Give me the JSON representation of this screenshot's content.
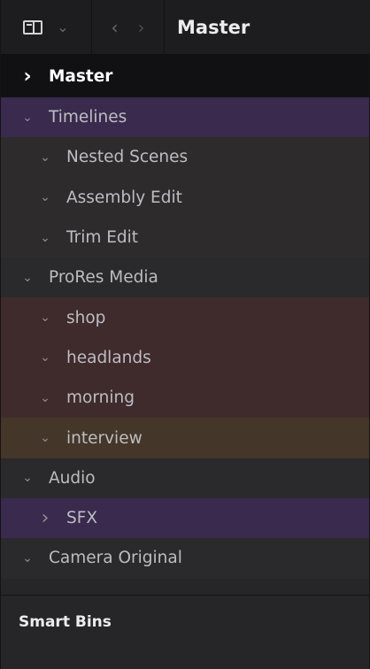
{
  "header": {
    "view_icon": "sidebar-icon",
    "view_chevron": "chevron-down-icon",
    "back_icon": "chevron-left-icon",
    "forward_icon": "chevron-right-icon",
    "title": "Master"
  },
  "bins": [
    {
      "label": "Master",
      "level": 0,
      "expanded": false,
      "color": "#111113"
    },
    {
      "label": "Timelines",
      "level": 0,
      "expanded": true,
      "color": "#3a2a4e"
    },
    {
      "label": "Nested Scenes",
      "level": 1,
      "expanded": true,
      "color": "#2e2b2c"
    },
    {
      "label": "Assembly Edit",
      "level": 1,
      "expanded": true,
      "color": "#2e2b2c"
    },
    {
      "label": "Trim Edit",
      "level": 1,
      "expanded": true,
      "color": "#2e2b2c"
    },
    {
      "label": "ProRes Media",
      "level": 0,
      "expanded": true,
      "color": "#2a2a2c"
    },
    {
      "label": "shop",
      "level": 1,
      "expanded": true,
      "color": "#3f2a2c"
    },
    {
      "label": "headlands",
      "level": 1,
      "expanded": true,
      "color": "#3f2a2c"
    },
    {
      "label": "morning",
      "level": 1,
      "expanded": true,
      "color": "#3f2a2c"
    },
    {
      "label": "interview",
      "level": 1,
      "expanded": true,
      "color": "#45362a"
    },
    {
      "label": "Audio",
      "level": 0,
      "expanded": true,
      "color": "#2a2a2c"
    },
    {
      "label": "SFX",
      "level": 1,
      "expanded": false,
      "color": "#3a2a4e"
    },
    {
      "label": "Camera Original",
      "level": 0,
      "expanded": true,
      "color": "#2a2a2c"
    }
  ],
  "smart_bins": {
    "label": "Smart Bins"
  }
}
